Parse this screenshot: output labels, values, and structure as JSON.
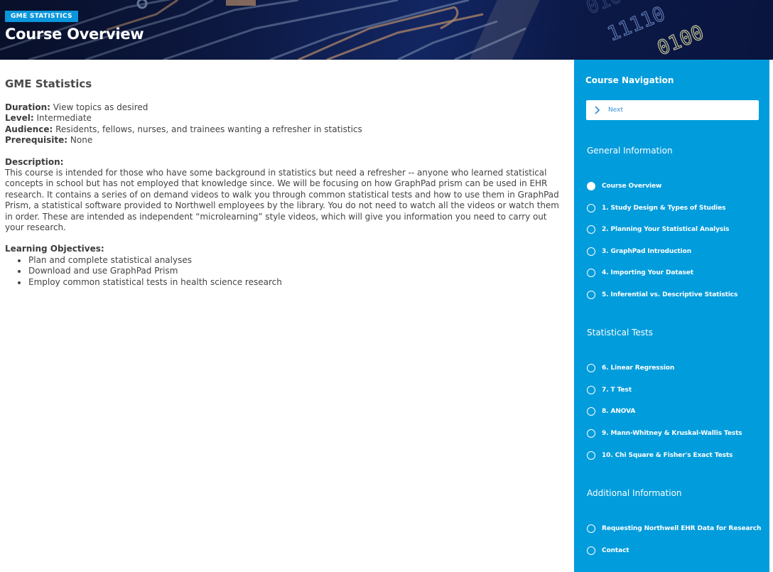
{
  "header": {
    "tag": "GME STATISTICS",
    "title": "Course Overview"
  },
  "main": {
    "heading": "GME Statistics",
    "meta": [
      {
        "label": "Duration:",
        "value": " View topics as desired"
      },
      {
        "label": "Level:",
        "value": " Intermediate"
      },
      {
        "label": "Audience:",
        "value": " Residents, fellows, nurses, and trainees wanting a refresher in statistics"
      },
      {
        "label": "Prerequisite:",
        "value": " None"
      }
    ],
    "description_label": "Description:",
    "description": "This course is intended for those who have some background in statistics but need a refresher -- anyone who learned statistical concepts in school but has not employed that knowledge since. We will be focusing on how GraphPad prism can be used in EHR research. It contains a series of on demand videos to walk you through common statistical tests and how to use them in GraphPad Prism, a statistical software provided to Northwell employees by the library. You do not need to watch all the videos or watch them in order. These are intended as independent “microlearning” style videos, which will give you information you need to carry out your research.",
    "objectives_label": "Learning Objectives:",
    "objectives": [
      "Plan and complete statistical analyses",
      "Download and use GraphPad Prism",
      "Employ common statistical tests in health science research"
    ]
  },
  "sidebar": {
    "title": "Course Navigation",
    "next_label": "Next",
    "groups": [
      {
        "title": "General Information",
        "items": [
          {
            "label": "Course Overview",
            "current": true
          },
          {
            "label": "1. Study Design & Types of Studies",
            "current": false
          },
          {
            "label": "2. Planning Your Statistical Analysis",
            "current": false
          },
          {
            "label": "3. GraphPad Introduction",
            "current": false
          },
          {
            "label": "4. Importing Your Dataset",
            "current": false
          },
          {
            "label": "5. Inferential vs. Descriptive Statistics",
            "current": false
          }
        ]
      },
      {
        "title": "Statistical Tests",
        "items": [
          {
            "label": "6. Linear Regression",
            "current": false
          },
          {
            "label": "7. T Test",
            "current": false
          },
          {
            "label": "8. ANOVA",
            "current": false
          },
          {
            "label": "9. Mann-Whitney & Kruskal-Wallis Tests",
            "current": false
          },
          {
            "label": "10. Chi Square & Fisher's Exact Tests",
            "current": false
          }
        ]
      },
      {
        "title": "Additional Information",
        "items": [
          {
            "label": "Requesting Northwell EHR Data for Research",
            "current": false
          },
          {
            "label": "Contact",
            "current": false
          }
        ]
      }
    ]
  },
  "colors": {
    "sidebar_bg": "#019cdc",
    "tag_bg": "#0a96dc",
    "next_text": "#3a8fd6"
  }
}
